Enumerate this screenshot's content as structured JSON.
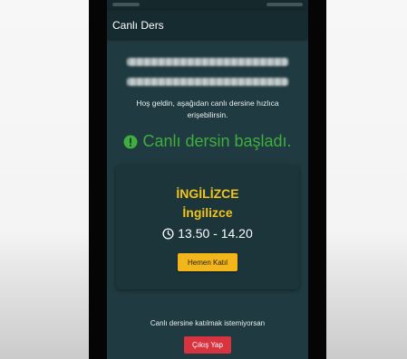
{
  "app_bar": {
    "title": "Canlı Ders"
  },
  "main": {
    "welcome_line1": "Hoş geldin, aşağıdan canlı dersine hızlıca",
    "welcome_line2": "erişebilirsin.",
    "status_message": "Canlı dersin başladı.",
    "status_icon": "exclamation-circle-icon"
  },
  "lesson_card": {
    "course_title_upper": "İNGİLİZCE",
    "course_title": "İngilizce",
    "time_icon": "clock-icon",
    "time_range": "13.50 - 14.20",
    "join_label": "Hemen Katıl"
  },
  "footer": {
    "leave_text": "Canlı dersine katılmak istemiyorsan",
    "logout_label": "Çıkış Yap"
  },
  "colors": {
    "background": "#1f3a40",
    "app_bar": "#162b30",
    "success": "#3fae3c",
    "accent": "#f2c31a",
    "join_button": "#f2b51a",
    "logout_button": "#d7343f"
  }
}
